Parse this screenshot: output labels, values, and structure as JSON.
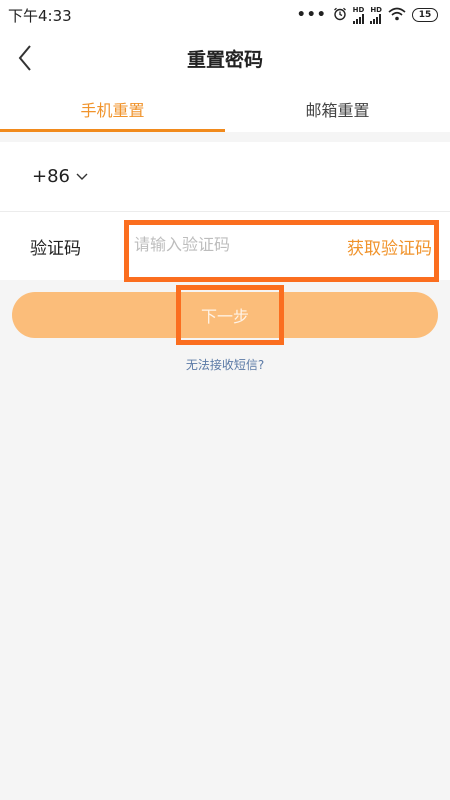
{
  "status_bar": {
    "time": "下午4:33",
    "dots": "•••",
    "signal_1_label": "HD",
    "signal_2_label": "HD",
    "battery": "15"
  },
  "header": {
    "title": "重置密码"
  },
  "tabs": [
    {
      "label": "手机重置",
      "active": true
    },
    {
      "label": "邮箱重置",
      "active": false
    }
  ],
  "phone_row": {
    "country_code": "+86",
    "phone_value": "",
    "phone_placeholder": ""
  },
  "code_row": {
    "label": "验证码",
    "placeholder": "请输入验证码",
    "value": "",
    "get_code_label": "获取验证码"
  },
  "next_button": {
    "label": "下一步"
  },
  "help_link": {
    "label": "无法接收短信?"
  },
  "colors": {
    "accent": "#f0932b",
    "button_disabled": "#fbbd7a",
    "highlight": "#fb6e1f",
    "link": "#5b7aa6",
    "background": "#f5f5f5"
  }
}
